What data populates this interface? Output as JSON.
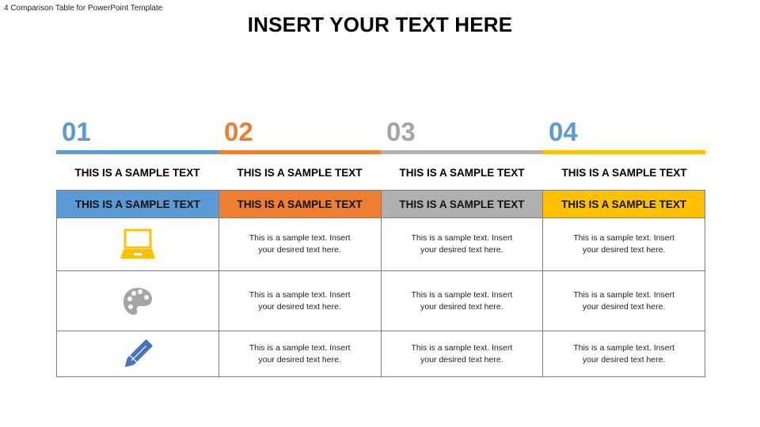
{
  "document_label": "4 Comparison Table for PowerPoint Template",
  "title": "INSERT YOUR TEXT HERE",
  "colors": {
    "blue": "#5b9bd5",
    "orange": "#ed7d31",
    "gray": "#a5a5a5",
    "yellow": "#ffc000",
    "icon_blue": "#4472c4",
    "border": "#7f7f7f"
  },
  "columns": [
    {
      "number": "01",
      "subheading": "THIS IS A SAMPLE TEXT",
      "header": "THIS IS A SAMPLE TEXT",
      "color_key": "blue"
    },
    {
      "number": "02",
      "subheading": "THIS IS A SAMPLE TEXT",
      "header": "THIS IS A SAMPLE TEXT",
      "color_key": "orange"
    },
    {
      "number": "03",
      "subheading": "THIS IS A SAMPLE TEXT",
      "header": "THIS IS A SAMPLE TEXT",
      "color_key": "gray"
    },
    {
      "number": "04",
      "subheading": "THIS IS A SAMPLE TEXT",
      "header": "THIS IS A SAMPLE TEXT",
      "color_key": "yellow"
    }
  ],
  "rows": [
    {
      "icon": "laptop-icon",
      "cells": [
        "This is a sample text. Insert your desired text here.",
        "This is a sample text. Insert your desired text here.",
        "This is a sample text. Insert your desired text here."
      ]
    },
    {
      "icon": "palette-icon",
      "cells": [
        "This is a sample text. Insert your desired text here.",
        "This is a sample text. Insert your desired text here.",
        "This is a sample text. Insert your desired text here."
      ]
    },
    {
      "icon": "pencil-icon",
      "cells": [
        "This is a sample text. Insert your desired text here.",
        "This is a sample text. Insert your desired text here.",
        "This is a sample text. Insert your desired text here."
      ]
    }
  ]
}
